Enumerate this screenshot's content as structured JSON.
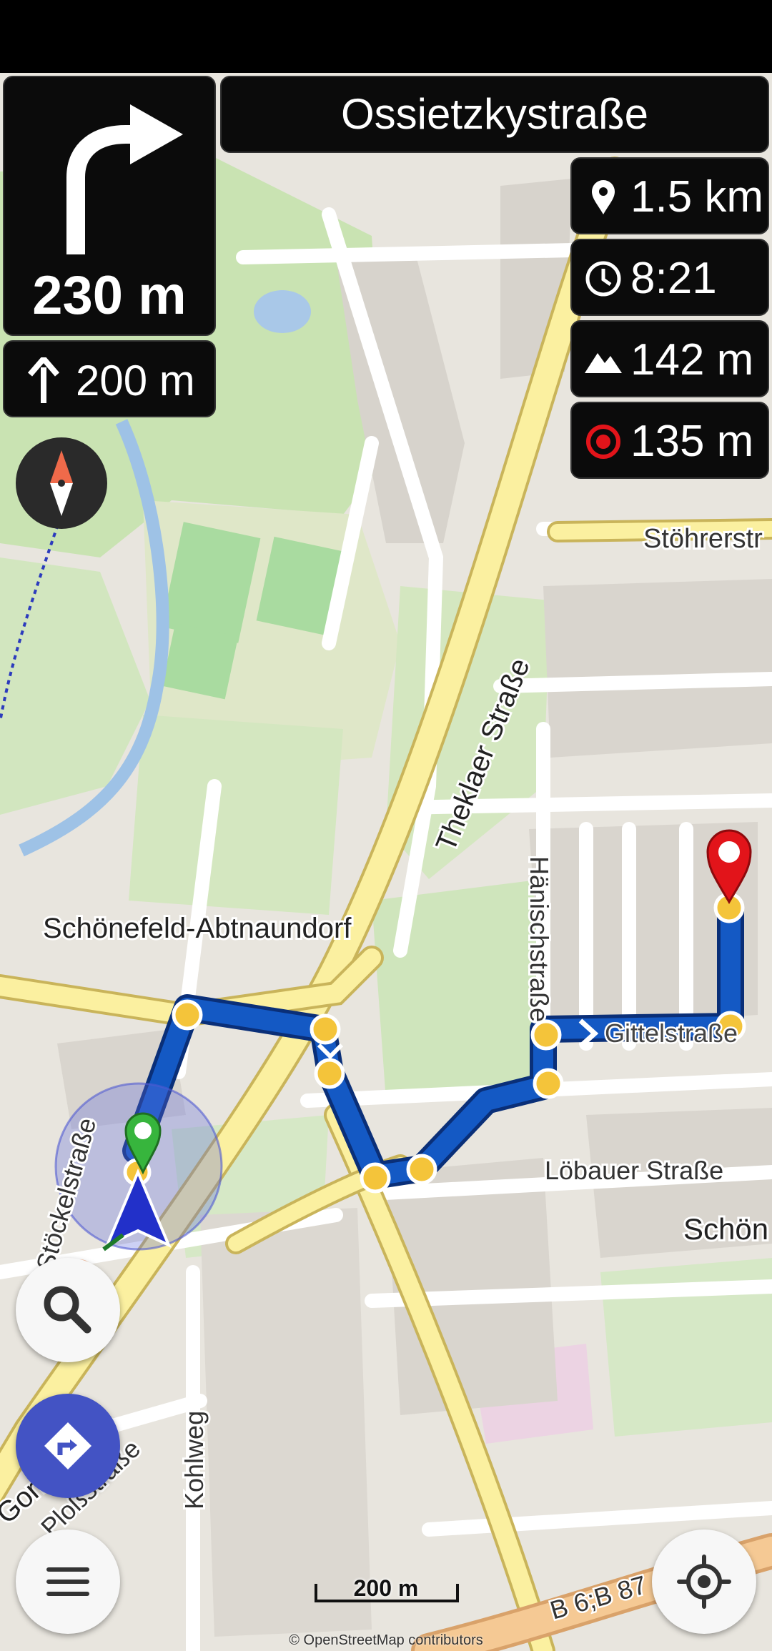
{
  "navigation": {
    "turn_distance": "230 m",
    "then_distance": "200 m",
    "current_street": "Ossietzkystraße"
  },
  "route_info": {
    "distance": "1.5 km",
    "time": "8:21",
    "elevation": "142 m",
    "target_distance": "135 m"
  },
  "map_labels": {
    "district": "Schönefeld-Abtnaundorf",
    "theklaer": "Theklaer Straße",
    "stoehrer": "Stöhrerstr",
    "haenisch": "Hänischstraße",
    "gittel": "Gittelstraße",
    "loebauer": "Löbauer Straße",
    "schoen": "Schön",
    "stoeckel": "Stöckelstraße",
    "gorki": "Gorkistraße",
    "plosz": "Ploßstraße",
    "kohlweg": "Kohlweg",
    "b6": "B 6;B 87"
  },
  "scale": "200 m",
  "attribution": "© OpenStreetMap contributors",
  "icons": {
    "turn": "turn-right-arrow-icon",
    "then": "straight-arrow-icon",
    "distance": "location-pin-icon",
    "time": "clock-icon",
    "elevation": "mountain-icon",
    "target": "target-icon",
    "compass": "compass-icon",
    "search": "search-icon",
    "navigate": "navigation-diamond-icon",
    "menu": "menu-icon",
    "locate": "my-location-icon"
  },
  "colors": {
    "route": "#1459c4",
    "waypoint": "#f4c43a",
    "nav_button": "#4353c4",
    "target": "#e2141a",
    "panel": "#0b0b0b"
  }
}
